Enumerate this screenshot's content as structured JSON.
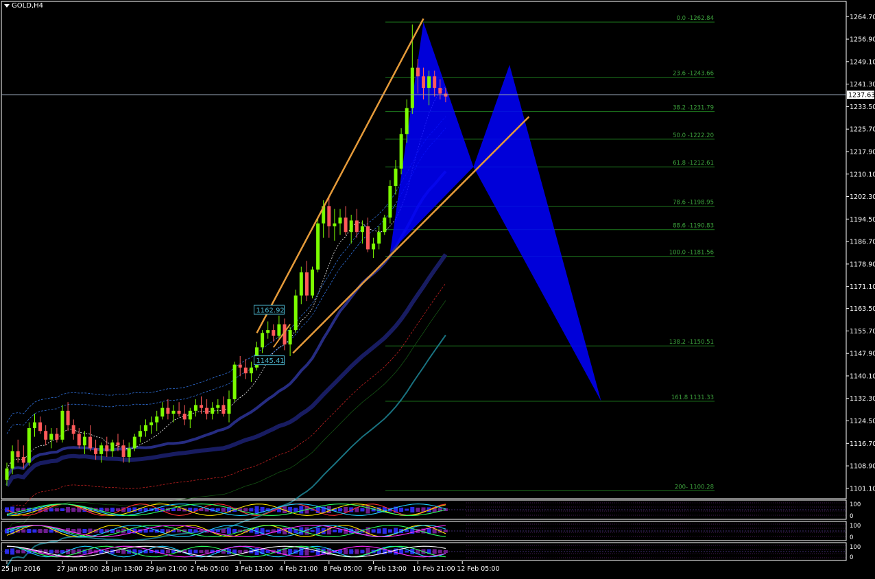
{
  "window": {
    "symbol_title": "GOLD,H4"
  },
  "chart_data": {
    "type": "candlestick",
    "symbol": "GOLD",
    "timeframe": "H4",
    "ylim": [
      1097.5,
      1270.0
    ],
    "y_ticks": [
      "1264.70",
      "1256.90",
      "1249.10",
      "1241.30",
      "1233.50",
      "1225.70",
      "1217.90",
      "1210.10",
      "1202.30",
      "1194.50",
      "1186.70",
      "1178.90",
      "1171.10",
      "1163.50",
      "1155.70",
      "1147.90",
      "1140.10",
      "1132.30",
      "1124.50",
      "1116.70",
      "1108.90",
      "1101.10"
    ],
    "x_ticks": [
      {
        "label": "25 Jan 2016",
        "idx": 0
      },
      {
        "label": "27 Jan 05:00",
        "idx": 10
      },
      {
        "label": "28 Jan 13:00",
        "idx": 18
      },
      {
        "label": "29 Jan 21:00",
        "idx": 26
      },
      {
        "label": "2 Feb 05:00",
        "idx": 34
      },
      {
        "label": "3 Feb 13:00",
        "idx": 42
      },
      {
        "label": "4 Feb 21:00",
        "idx": 50
      },
      {
        "label": "8 Feb 05:00",
        "idx": 58
      },
      {
        "label": "9 Feb 13:00",
        "idx": 66
      },
      {
        "label": "10 Feb 21:00",
        "idx": 74
      },
      {
        "label": "12 Feb 05:00",
        "idx": 82
      }
    ],
    "current_price": "1237.63",
    "candles": [
      [
        1104,
        1110,
        1102,
        1108
      ],
      [
        1108,
        1116,
        1106,
        1114
      ],
      [
        1114,
        1118,
        1110,
        1112
      ],
      [
        1112,
        1116,
        1108,
        1110
      ],
      [
        1110,
        1124,
        1109,
        1122
      ],
      [
        1122,
        1127,
        1119,
        1124
      ],
      [
        1124,
        1126,
        1120,
        1121
      ],
      [
        1121,
        1123,
        1116,
        1118
      ],
      [
        1118,
        1122,
        1115,
        1120
      ],
      [
        1120,
        1122,
        1117,
        1118
      ],
      [
        1118,
        1130,
        1117,
        1128
      ],
      [
        1128,
        1131,
        1121,
        1123
      ],
      [
        1123,
        1125,
        1118,
        1120
      ],
      [
        1120,
        1122,
        1115,
        1116
      ],
      [
        1116,
        1121,
        1113,
        1119
      ],
      [
        1119,
        1123,
        1114,
        1115
      ],
      [
        1115,
        1118,
        1111,
        1113
      ],
      [
        1113,
        1117,
        1110,
        1116
      ],
      [
        1116,
        1119,
        1112,
        1114
      ],
      [
        1114,
        1118,
        1112,
        1117
      ],
      [
        1117,
        1120,
        1114,
        1116
      ],
      [
        1116,
        1118,
        1110,
        1112
      ],
      [
        1112,
        1117,
        1110,
        1115
      ],
      [
        1115,
        1120,
        1114,
        1119
      ],
      [
        1119,
        1123,
        1117,
        1121
      ],
      [
        1121,
        1125,
        1119,
        1123
      ],
      [
        1123,
        1126,
        1120,
        1124
      ],
      [
        1124,
        1128,
        1121,
        1126
      ],
      [
        1126,
        1131,
        1125,
        1129
      ],
      [
        1129,
        1132,
        1125,
        1127
      ],
      [
        1127,
        1130,
        1124,
        1128
      ],
      [
        1128,
        1131,
        1126,
        1127
      ],
      [
        1127,
        1130,
        1123,
        1125
      ],
      [
        1125,
        1129,
        1122,
        1128
      ],
      [
        1128,
        1132,
        1126,
        1130
      ],
      [
        1130,
        1133,
        1127,
        1129
      ],
      [
        1129,
        1132,
        1125,
        1127
      ],
      [
        1127,
        1131,
        1125,
        1129
      ],
      [
        1129,
        1132,
        1127,
        1130
      ],
      [
        1130,
        1133,
        1126,
        1127
      ],
      [
        1127,
        1135,
        1124,
        1132
      ],
      [
        1132,
        1145,
        1131,
        1144
      ],
      [
        1144,
        1147,
        1140,
        1143
      ],
      [
        1143,
        1146,
        1139,
        1141
      ],
      [
        1141,
        1145,
        1138,
        1143
      ],
      [
        1143,
        1152,
        1142,
        1150
      ],
      [
        1150,
        1156,
        1148,
        1155
      ],
      [
        1155,
        1159,
        1153,
        1156
      ],
      [
        1156,
        1158,
        1152,
        1154
      ],
      [
        1154,
        1161,
        1153,
        1158
      ],
      [
        1158,
        1160,
        1149,
        1151
      ],
      [
        1151,
        1157,
        1147,
        1156
      ],
      [
        1156,
        1170,
        1155,
        1168
      ],
      [
        1168,
        1178,
        1165,
        1176
      ],
      [
        1176,
        1180,
        1166,
        1168
      ],
      [
        1168,
        1178,
        1167,
        1177
      ],
      [
        1177,
        1195,
        1176,
        1193
      ],
      [
        1193,
        1201,
        1188,
        1199
      ],
      [
        1199,
        1202,
        1188,
        1192
      ],
      [
        1192,
        1198,
        1187,
        1193
      ],
      [
        1193,
        1198,
        1189,
        1195
      ],
      [
        1195,
        1199,
        1189,
        1190
      ],
      [
        1190,
        1196,
        1186,
        1194
      ],
      [
        1194,
        1198,
        1188,
        1190
      ],
      [
        1190,
        1194,
        1186,
        1192
      ],
      [
        1192,
        1195,
        1183,
        1184
      ],
      [
        1184,
        1188,
        1181,
        1186
      ],
      [
        1186,
        1192,
        1184,
        1190
      ],
      [
        1190,
        1196,
        1189,
        1195
      ],
      [
        1195,
        1208,
        1193,
        1206
      ],
      [
        1206,
        1215,
        1203,
        1212
      ],
      [
        1212,
        1226,
        1210,
        1224
      ],
      [
        1224,
        1236,
        1221,
        1233
      ],
      [
        1233,
        1262,
        1231,
        1247
      ],
      [
        1247,
        1250,
        1238,
        1244
      ],
      [
        1244,
        1247,
        1236,
        1240
      ],
      [
        1240,
        1246,
        1234,
        1244
      ],
      [
        1244,
        1246,
        1237,
        1240
      ],
      [
        1240,
        1243,
        1236,
        1238
      ],
      [
        1238,
        1240,
        1235,
        1237
      ]
    ],
    "fibonacci": [
      {
        "label": "0.0 -1262.84",
        "price": 1262.84
      },
      {
        "label": "23.6 -1243.66",
        "price": 1243.66
      },
      {
        "label": "38.2 -1231.79",
        "price": 1231.79
      },
      {
        "label": "50.0 -1222.20",
        "price": 1222.2
      },
      {
        "label": "61.8 -1212.61",
        "price": 1212.61
      },
      {
        "label": "78.6 -1198.95",
        "price": 1198.95
      },
      {
        "label": "88.6 -1190.83",
        "price": 1190.83
      },
      {
        "label": "100.0 -1181.56",
        "price": 1181.56
      },
      {
        "label": "138.2 -1150.51",
        "price": 1150.51
      },
      {
        "label": "161.8 1131.33",
        "price": 1131.33
      },
      {
        "label": "200- 1100.28",
        "price": 1100.28
      }
    ],
    "price_labels": [
      {
        "text": "1162.92",
        "price": 1162.92
      },
      {
        "text": "1145.41",
        "price": 1145.41
      }
    ],
    "subwindows": [
      {
        "name": "indicator-1",
        "scale": [
          "100",
          "0"
        ]
      },
      {
        "name": "indicator-2",
        "scale": [
          "100",
          "0"
        ]
      },
      {
        "name": "indicator-3",
        "scale": [
          "100",
          "0"
        ]
      }
    ],
    "colors": {
      "bull": "#7CFC00",
      "bear": "#FF5A5A",
      "fib": "#1E7A1E",
      "fib_text": "#3CA03C",
      "trend": "#E69B3A",
      "pattern": "#0000FF",
      "axis": "#FFFFFF"
    }
  }
}
